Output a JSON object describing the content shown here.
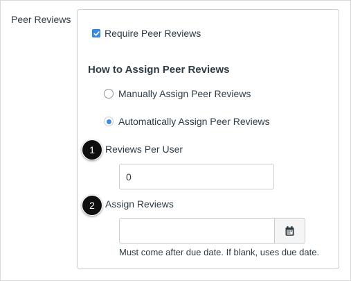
{
  "section": {
    "label": "Peer Reviews"
  },
  "require_checkbox": {
    "label": "Require Peer Reviews",
    "checked": true
  },
  "assign_heading": "How to Assign Peer Reviews",
  "assign_options": [
    {
      "label": "Manually Assign Peer Reviews",
      "selected": false
    },
    {
      "label": "Automatically Assign Peer Reviews",
      "selected": true
    }
  ],
  "callouts": [
    "1",
    "2"
  ],
  "reviews_per_user": {
    "label": "Reviews Per User",
    "value": "0"
  },
  "assign_reviews": {
    "label": "Assign Reviews",
    "value": "",
    "help": "Must come after due date. If blank, uses due date."
  },
  "icons": {
    "checkbox": "checkmark-icon",
    "date_picker": "calendar-icon"
  },
  "colors": {
    "accent": "#3d8be0",
    "text": "#2d3b45",
    "border": "#c7cdd1",
    "badge": "#0f0f0f"
  }
}
